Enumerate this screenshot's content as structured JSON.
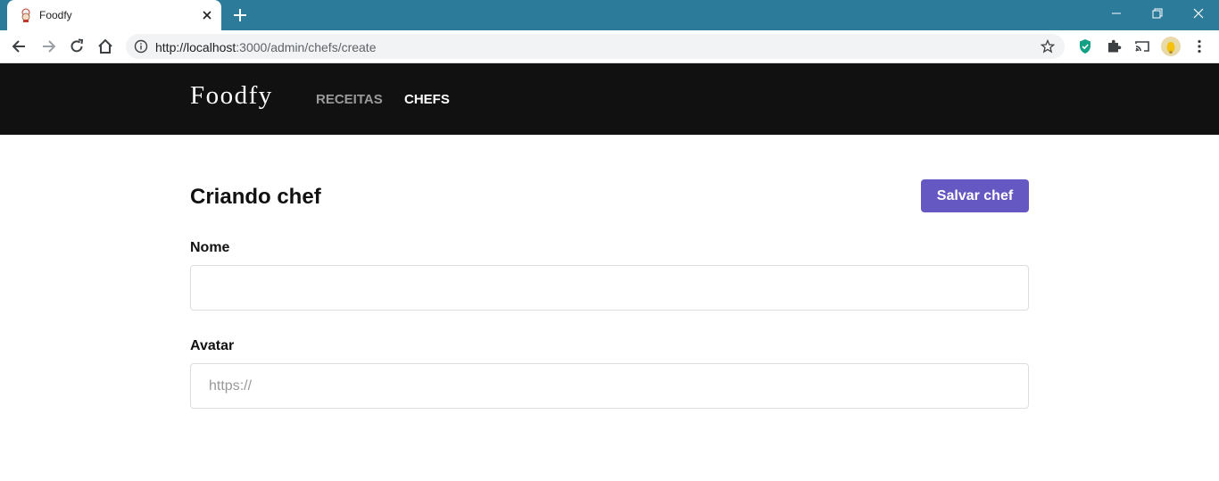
{
  "browser": {
    "tab_title": "Foodfy",
    "url_host": "http://localhost",
    "url_path": ":3000/admin/chefs/create"
  },
  "header": {
    "logo": "Foodfy",
    "nav": {
      "recipes": "RECEITAS",
      "chefs": "CHEFS"
    }
  },
  "main": {
    "title": "Criando chef",
    "save_label": "Salvar chef",
    "name_label": "Nome",
    "name_value": "",
    "name_placeholder": "",
    "avatar_label": "Avatar",
    "avatar_value": "",
    "avatar_placeholder": "https://"
  },
  "icons": {
    "favicon": "chef-favicon-icon",
    "tab_close": "close-icon",
    "new_tab": "plus-icon",
    "back": "arrow-left-icon",
    "forward": "arrow-right-icon",
    "reload": "reload-icon",
    "home": "home-icon",
    "info": "info-icon",
    "bookmark": "star-icon",
    "shield": "shield-icon",
    "extensions": "puzzle-icon",
    "cast": "cast-icon",
    "profile": "avatar-icon",
    "menu": "kebab-menu-icon"
  },
  "colors": {
    "tabstrip": "#2d7b9b",
    "header_bg": "#111111",
    "accent": "#6558c3",
    "nav_inactive": "#9a9a9a",
    "nav_active": "#ffffff"
  }
}
